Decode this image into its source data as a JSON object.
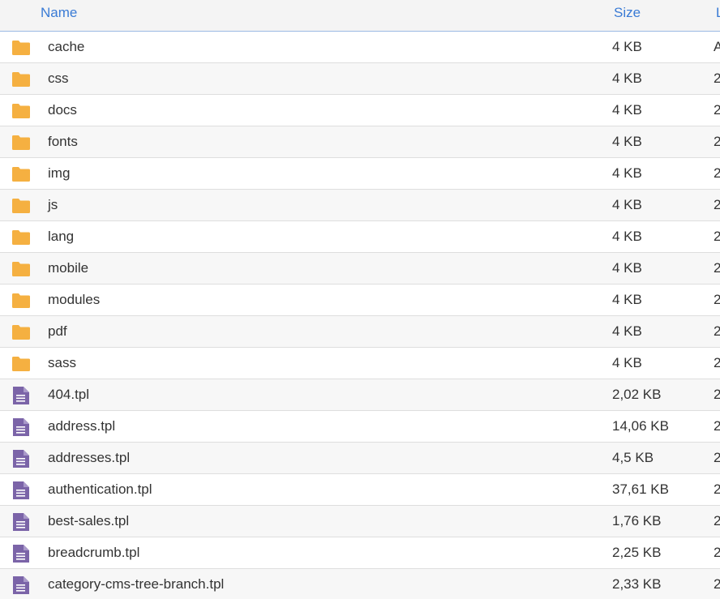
{
  "header": {
    "name_label": "Name",
    "size_label": "Size",
    "date_label": "L"
  },
  "colors": {
    "folder": "#f5b041",
    "file": "#7b64a8",
    "header_link": "#3a7bd5"
  },
  "rows": [
    {
      "type": "folder",
      "icon": "folder-icon",
      "name": "cache",
      "size": "4 KB",
      "date": "A"
    },
    {
      "type": "folder",
      "icon": "folder-icon",
      "name": "css",
      "size": "4 KB",
      "date": "2"
    },
    {
      "type": "folder",
      "icon": "folder-icon",
      "name": "docs",
      "size": "4 KB",
      "date": "2"
    },
    {
      "type": "folder",
      "icon": "folder-icon",
      "name": "fonts",
      "size": "4 KB",
      "date": "2"
    },
    {
      "type": "folder",
      "icon": "folder-icon",
      "name": "img",
      "size": "4 KB",
      "date": "2"
    },
    {
      "type": "folder",
      "icon": "folder-icon",
      "name": "js",
      "size": "4 KB",
      "date": "2"
    },
    {
      "type": "folder",
      "icon": "folder-icon",
      "name": "lang",
      "size": "4 KB",
      "date": "2"
    },
    {
      "type": "folder",
      "icon": "folder-icon",
      "name": "mobile",
      "size": "4 KB",
      "date": "2"
    },
    {
      "type": "folder",
      "icon": "folder-icon",
      "name": "modules",
      "size": "4 KB",
      "date": "2"
    },
    {
      "type": "folder",
      "icon": "folder-icon",
      "name": "pdf",
      "size": "4 KB",
      "date": "2"
    },
    {
      "type": "folder",
      "icon": "folder-icon",
      "name": "sass",
      "size": "4 KB",
      "date": "2"
    },
    {
      "type": "file",
      "icon": "file-text-icon",
      "name": "404.tpl",
      "size": "2,02 KB",
      "date": "2"
    },
    {
      "type": "file",
      "icon": "file-text-icon",
      "name": "address.tpl",
      "size": "14,06 KB",
      "date": "2"
    },
    {
      "type": "file",
      "icon": "file-text-icon",
      "name": "addresses.tpl",
      "size": "4,5 KB",
      "date": "2"
    },
    {
      "type": "file",
      "icon": "file-text-icon",
      "name": "authentication.tpl",
      "size": "37,61 KB",
      "date": "2"
    },
    {
      "type": "file",
      "icon": "file-text-icon",
      "name": "best-sales.tpl",
      "size": "1,76 KB",
      "date": "2"
    },
    {
      "type": "file",
      "icon": "file-text-icon",
      "name": "breadcrumb.tpl",
      "size": "2,25 KB",
      "date": "2"
    },
    {
      "type": "file",
      "icon": "file-text-icon",
      "name": "category-cms-tree-branch.tpl",
      "size": "2,33 KB",
      "date": "2"
    }
  ]
}
